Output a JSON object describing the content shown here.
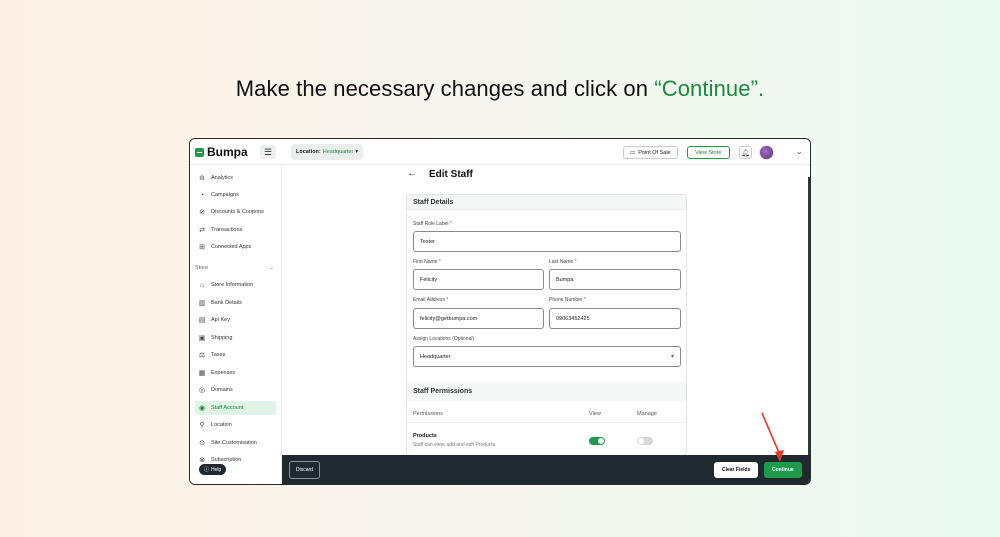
{
  "instruction": {
    "prefix": "Make the necessary changes and click on ",
    "highlight": "“Continue”.",
    "highlight_color": "#1a8a3c"
  },
  "app": {
    "brand": "Bumpa",
    "accent_color": "#1f9a4b",
    "location_label": "Location:",
    "location_value": "Headquarter",
    "point_of_sale": "Point Of Sale",
    "view_store": "View Store"
  },
  "sidebar": {
    "items_top": [
      {
        "label": "Analytics",
        "icon": "bar-chart-icon"
      },
      {
        "label": "Campaigns",
        "icon": "megaphone-icon"
      },
      {
        "label": "Discounts & Coupons",
        "icon": "discount-icon"
      },
      {
        "label": "Transactions",
        "icon": "transfer-icon"
      },
      {
        "label": "Connected Apps",
        "icon": "apps-icon"
      }
    ],
    "store_section": "Store",
    "items_store": [
      {
        "label": "Store Information",
        "icon": "store-icon"
      },
      {
        "label": "Bank Details",
        "icon": "bank-icon"
      },
      {
        "label": "Api Key",
        "icon": "key-icon"
      },
      {
        "label": "Shipping",
        "icon": "truck-icon"
      },
      {
        "label": "Taxes",
        "icon": "tax-icon"
      },
      {
        "label": "Expenses",
        "icon": "expenses-icon"
      },
      {
        "label": "Domains",
        "icon": "globe-icon"
      },
      {
        "label": "Staff Account",
        "icon": "staff-icon",
        "active": true
      },
      {
        "label": "Location",
        "icon": "pin-icon"
      },
      {
        "label": "Site Customisation",
        "icon": "brush-icon"
      },
      {
        "label": "Subscription",
        "icon": "subscription-icon"
      }
    ],
    "help": "Help"
  },
  "page": {
    "title": "Edit Staff",
    "staff_details": "Staff Details",
    "fields": {
      "role_label": "Staff Role Label",
      "role_value": "Tester",
      "first_name_label": "First Name",
      "first_name_value": "Felicity",
      "last_name_label": "Last Name",
      "last_name_value": "Bumpa",
      "email_label": "Email Address",
      "email_value": "felicity@getbumpa.com",
      "phone_label": "Phone Number",
      "phone_value": "09063452425",
      "locations_label": "Assign Locations (Optional)",
      "locations_value": "Headquarter"
    },
    "permissions": {
      "title": "Staff Permissions",
      "col_permissions": "Permissions",
      "col_view": "View",
      "col_manage": "Manage",
      "rows": [
        {
          "title": "Products",
          "desc": "Staff can view, add and edit Products.",
          "view": true,
          "manage": false
        }
      ]
    }
  },
  "footer": {
    "discard": "Discard",
    "clear_fields": "Clear Fields",
    "continue": "Continue"
  }
}
